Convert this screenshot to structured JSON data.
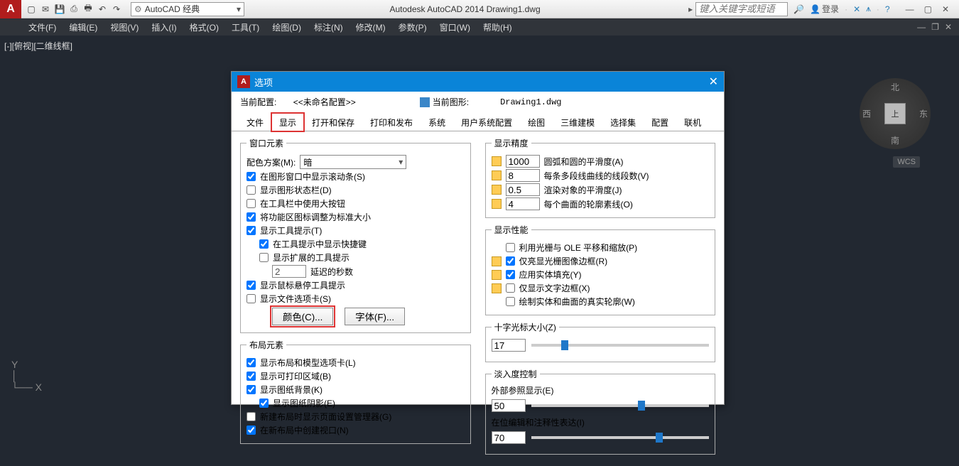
{
  "title": "Autodesk AutoCAD 2014   Drawing1.dwg",
  "workspace": "AutoCAD 经典",
  "search_placeholder": "键入关键字或短语",
  "login": "登录",
  "menus": [
    "文件(F)",
    "编辑(E)",
    "视图(V)",
    "插入(I)",
    "格式(O)",
    "工具(T)",
    "绘图(D)",
    "标注(N)",
    "修改(M)",
    "参数(P)",
    "窗口(W)",
    "帮助(H)"
  ],
  "viewport_label": "[-][俯视][二维线框]",
  "compass": {
    "n": "北",
    "s": "南",
    "e": "东",
    "w": "西",
    "cube": "上"
  },
  "wcs": "WCS",
  "dialog": {
    "title": "选项",
    "close": "✕",
    "current_config_label": "当前配置:",
    "current_config_value": "<<未命名配置>>",
    "current_drawing_label": "当前图形:",
    "current_drawing_value": "Drawing1.dwg",
    "tabs": [
      "文件",
      "显示",
      "打开和保存",
      "打印和发布",
      "系统",
      "用户系统配置",
      "绘图",
      "三维建模",
      "选择集",
      "配置",
      "联机"
    ],
    "left": {
      "window_elements": "窗口元素",
      "color_scheme_label": "配色方案(M):",
      "color_scheme_value": "暗",
      "cb_scrollbars": "在图形窗口中显示滚动条(S)",
      "cb_drawing_status": "显示图形状态栏(D)",
      "cb_large_buttons": "在工具栏中使用大按钮",
      "cb_ribbon_std_icons": "将功能区图标调整为标准大小",
      "cb_tooltips": "显示工具提示(T)",
      "cb_tooltips_shortcut": "在工具提示中显示快捷键",
      "cb_tooltips_ext": "显示扩展的工具提示",
      "sec_delay_label": "延迟的秒数",
      "sec_delay_value": "2",
      "cb_hover_tooltips": "显示鼠标悬停工具提示",
      "cb_file_tabs": "显示文件选项卡(S)",
      "btn_colors": "颜色(C)...",
      "btn_fonts": "字体(F)...",
      "layout_elements": "布局元素",
      "cb_layout_tabs": "显示布局和模型选项卡(L)",
      "cb_printable_area": "显示可打印区域(B)",
      "cb_paper_bg": "显示图纸背景(K)",
      "cb_paper_shadow": "显示图纸阴影(E)",
      "cb_page_setup_mgr": "新建布局时显示页面设置管理器(G)",
      "cb_viewport_new": "在新布局中创建视口(N)"
    },
    "right": {
      "display_resolution": "显示精度",
      "arc_smooth": {
        "val": "1000",
        "label": "圆弧和圆的平滑度(A)"
      },
      "polyline_seg": {
        "val": "8",
        "label": "每条多段线曲线的线段数(V)"
      },
      "render_smooth": {
        "val": "0.5",
        "label": "渲染对象的平滑度(J)"
      },
      "surface_lines": {
        "val": "4",
        "label": "每个曲面的轮廓素线(O)"
      },
      "display_perf": "显示性能",
      "cb_raster_ole": "利用光栅与 OLE 平移和缩放(P)",
      "cb_highlight_raster": "仅亮显光栅图像边框(R)",
      "cb_solid_fill": "应用实体填充(Y)",
      "cb_text_boundary": "仅显示文字边框(X)",
      "cb_true_silhouette": "绘制实体和曲面的真实轮廓(W)",
      "crosshair_label": "十字光标大小(Z)",
      "crosshair_value": "17",
      "fade_control": "淡入度控制",
      "xref_display_label": "外部参照显示(E)",
      "xref_display_value": "50",
      "inplace_edit_label": "在位编辑和注释性表达(I)",
      "inplace_edit_value": "70"
    }
  }
}
